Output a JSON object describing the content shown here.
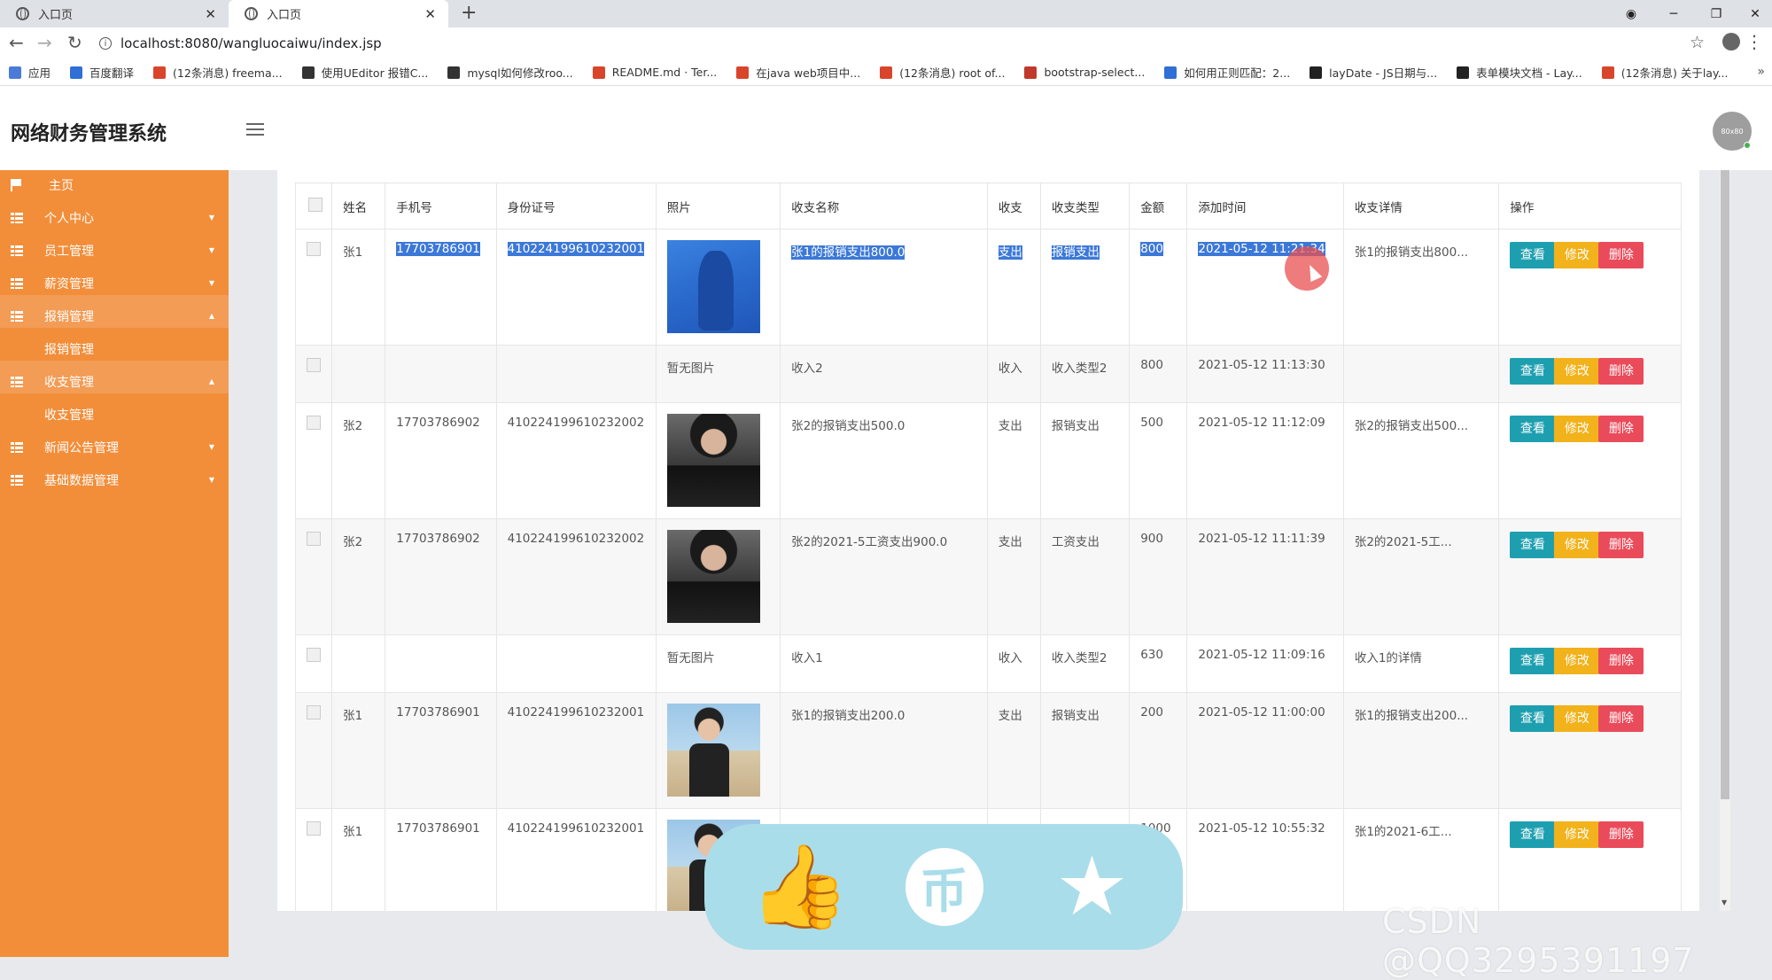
{
  "browser": {
    "tabs": [
      {
        "title": "入口页"
      },
      {
        "title": "入口页"
      }
    ],
    "new_tab": "+",
    "url": "localhost:8080/wangluocaiwu/index.jsp",
    "bookmarks": [
      {
        "label": "应用",
        "color": "#4a7bd8"
      },
      {
        "label": "百度翻译",
        "color": "#2f6fd6"
      },
      {
        "label": "(12条消息) freema...",
        "color": "#d9452b"
      },
      {
        "label": "使用UEditor 报错C...",
        "color": "#333333"
      },
      {
        "label": "mysql如何修改roo...",
        "color": "#333333"
      },
      {
        "label": "README.md · Ter...",
        "color": "#d9452b"
      },
      {
        "label": "在java web项目中...",
        "color": "#d9452b"
      },
      {
        "label": "(12条消息) root of...",
        "color": "#d9452b"
      },
      {
        "label": "bootstrap-select...",
        "color": "#c0392b"
      },
      {
        "label": "如何用正则匹配：2...",
        "color": "#2f6fd6"
      },
      {
        "label": "layDate - JS日期与...",
        "color": "#222222"
      },
      {
        "label": "表单模块文档 - Lay...",
        "color": "#222222"
      },
      {
        "label": "(12条消息) 关于lay...",
        "color": "#d9452b"
      }
    ],
    "more": "»"
  },
  "app": {
    "title": "网络财务管理系统",
    "avatar_text": "80x80"
  },
  "sidebar": {
    "items": [
      {
        "label": "主页",
        "icon": "flag-icon",
        "arrow": ""
      },
      {
        "label": "个人中心",
        "icon": "grid-icon",
        "arrow": "▼"
      },
      {
        "label": "员工管理",
        "icon": "grid-icon",
        "arrow": "▼"
      },
      {
        "label": "薪资管理",
        "icon": "grid-icon",
        "arrow": "▼"
      },
      {
        "label": "报销管理",
        "icon": "grid-icon",
        "arrow": "▲"
      },
      {
        "label": "报销管理",
        "sub": true
      },
      {
        "label": "收支管理",
        "icon": "grid-icon",
        "arrow": "▲"
      },
      {
        "label": "收支管理",
        "sub": true
      },
      {
        "label": "新闻公告管理",
        "icon": "grid-icon",
        "arrow": "▼"
      },
      {
        "label": "基础数据管理",
        "icon": "grid-icon",
        "arrow": "▼"
      }
    ]
  },
  "table": {
    "headers": [
      "姓名",
      "手机号",
      "身份证号",
      "照片",
      "收支名称",
      "收支",
      "收支类型",
      "金额",
      "添加时间",
      "收支详情",
      "操作"
    ],
    "actions": {
      "view": "查看",
      "edit": "修改",
      "delete": "删除"
    },
    "no_photo": "暂无图片",
    "rows": [
      {
        "name": "张1",
        "phone": "17703786901",
        "idcard": "410224199610232001",
        "photo": "blue",
        "title": "张1的报销支出800.0",
        "io": "支出",
        "type": "报销支出",
        "amount": "800",
        "time": "2021-05-12 11:21:34",
        "detail": "张1的报销支出800...",
        "selected": true
      },
      {
        "name": "",
        "phone": "",
        "idcard": "",
        "photo": "none",
        "title": "收入2",
        "io": "收入",
        "type": "收入类型2",
        "amount": "800",
        "time": "2021-05-12 11:13:30",
        "detail": ""
      },
      {
        "name": "张2",
        "phone": "17703786902",
        "idcard": "410224199610232002",
        "photo": "dark",
        "title": "张2的报销支出500.0",
        "io": "支出",
        "type": "报销支出",
        "amount": "500",
        "time": "2021-05-12 11:12:09",
        "detail": "张2的报销支出500..."
      },
      {
        "name": "张2",
        "phone": "17703786902",
        "idcard": "410224199610232002",
        "photo": "dark",
        "title": "张2的2021-5工资支出900.0",
        "io": "支出",
        "type": "工资支出",
        "amount": "900",
        "time": "2021-05-12 11:11:39",
        "detail": "张2的2021-5工..."
      },
      {
        "name": "",
        "phone": "",
        "idcard": "",
        "photo": "none",
        "title": "收入1",
        "io": "收入",
        "type": "收入类型2",
        "amount": "630",
        "time": "2021-05-12 11:09:16",
        "detail": "收入1的详情"
      },
      {
        "name": "张1",
        "phone": "17703786901",
        "idcard": "410224199610232001",
        "photo": "beach",
        "title": "张1的报销支出200.0",
        "io": "支出",
        "type": "报销支出",
        "amount": "200",
        "time": "2021-05-12 11:00:00",
        "detail": "张1的报销支出200..."
      },
      {
        "name": "张1",
        "phone": "17703786901",
        "idcard": "410224199610232001",
        "photo": "beach",
        "title": "",
        "io": "",
        "type": "",
        "amount": "1000",
        "time": "2021-05-12 10:55:32",
        "detail": "张1的2021-6工..."
      }
    ]
  },
  "floating_bar": {
    "like": "👍",
    "coin": "币",
    "favorite": "★"
  },
  "watermark": "CSDN @QQ3295391197"
}
